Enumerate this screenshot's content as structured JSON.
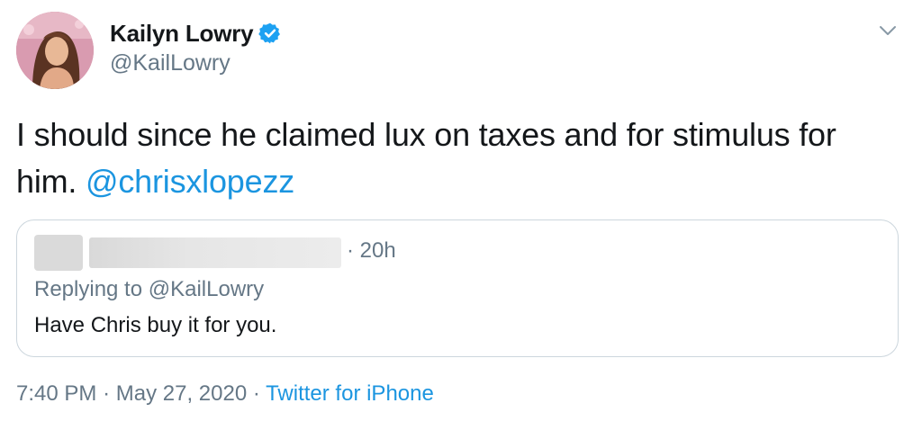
{
  "author": {
    "display_name": "Kailyn Lowry",
    "handle": "@KailLowry",
    "verified": true
  },
  "tweet": {
    "text": "I should since he claimed lux on taxes and for stimulus for him.",
    "mention": "@chrisxlopezz"
  },
  "quoted_tweet": {
    "time_sep": "·",
    "time": "20h",
    "replying_to_label": "Replying to",
    "replying_to_handle": "@KailLowry",
    "text": "Have Chris buy it for you."
  },
  "meta": {
    "time": "7:40 PM",
    "sep1": "·",
    "date": "May 27, 2020",
    "sep2": "·",
    "source": "Twitter for iPhone"
  },
  "colors": {
    "link": "#1b95e0",
    "secondary_text": "#657786",
    "primary_text": "#14171a",
    "border": "#ccd6dd",
    "verified_badge": "#1da1f2"
  },
  "icons": {
    "verified": "verified-badge-icon",
    "more": "chevron-down-icon"
  }
}
